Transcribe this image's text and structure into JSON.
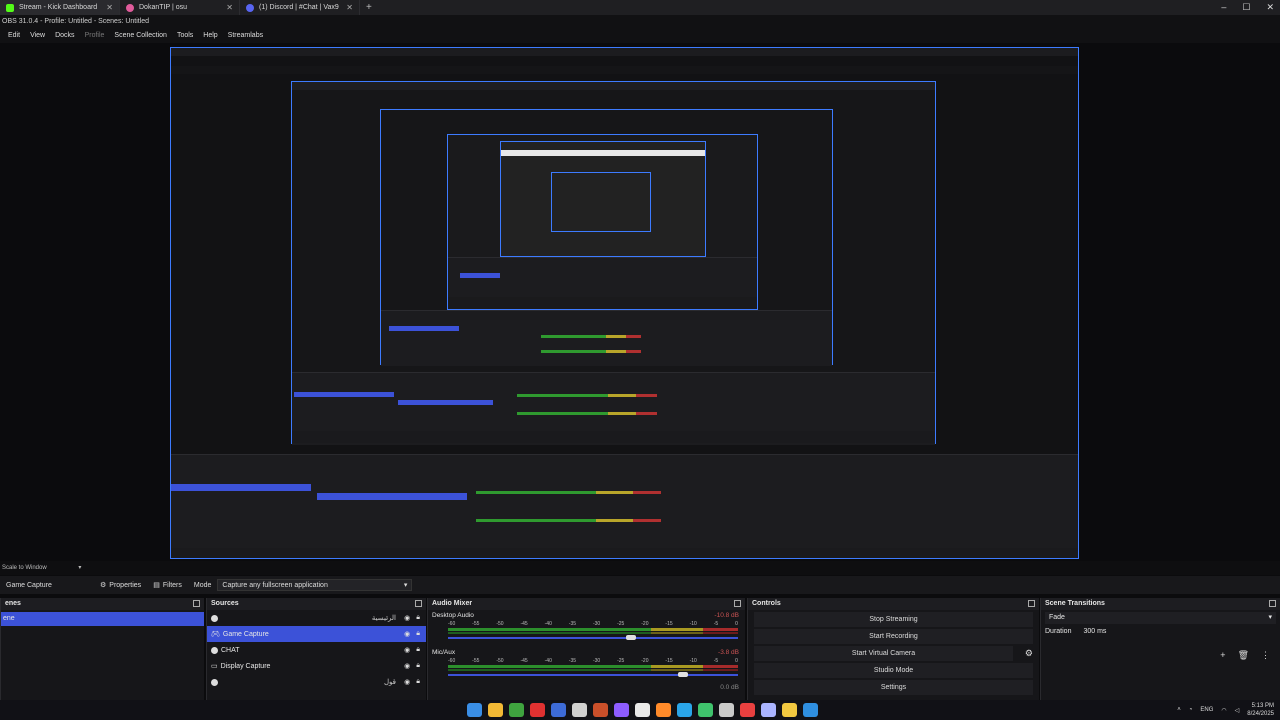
{
  "browser": {
    "tabs": [
      {
        "label": "Stream - Kick Dashboard",
        "color": "#53fc18"
      },
      {
        "label": "DokanTIP | osu",
        "color": "#e05b9b"
      },
      {
        "label": "(1) Discord | #Chat | Vax9",
        "color": "#5865f2"
      }
    ],
    "new_tab": "+"
  },
  "window": {
    "title": "OBS 31.0.4 - Profile: Untitled - Scenes: Untitled",
    "menu": [
      "Edit",
      "View",
      "Docks",
      "Profile",
      "Scene Collection",
      "Tools",
      "Help",
      "Streamlabs"
    ]
  },
  "scale_label": "Scale to Window",
  "source_toolbar": {
    "source_name": "Game Capture",
    "properties": "Properties",
    "filters": "Filters",
    "mode_label": "Mode",
    "mode_value": "Capture any fullscreen application"
  },
  "scenes": {
    "title": "enes",
    "items": [
      "ene"
    ]
  },
  "sources": {
    "title": "Sources",
    "items": [
      {
        "name": "",
        "rtl": "الرئيسية"
      },
      {
        "name": "Game Capture",
        "rtl": ""
      },
      {
        "name": "CHAT",
        "rtl": ""
      },
      {
        "name": "Display Capture",
        "rtl": ""
      },
      {
        "name": "",
        "rtl": "قول"
      }
    ]
  },
  "mixer": {
    "title": "Audio Mixer",
    "channels": [
      {
        "name": "Desktop Audio",
        "db": "-10.8 dB",
        "level": 0.63
      },
      {
        "name": "Mic/Aux",
        "db": "-3.8 dB",
        "level": 0.81
      }
    ],
    "ticks": [
      "-60",
      "-55",
      "-50",
      "-45",
      "-40",
      "-35",
      "-30",
      "-25",
      "-20",
      "-15",
      "-10",
      "-5",
      "0"
    ],
    "third_db": "0.0 dB"
  },
  "controls": {
    "title": "Controls",
    "buttons": [
      "Stop Streaming",
      "Start Recording",
      "Start Virtual Camera",
      "Studio Mode",
      "Settings"
    ]
  },
  "transitions": {
    "title": "Scene Transitions",
    "selected": "Fade",
    "duration_label": "Duration",
    "duration_value": "300 ms"
  },
  "taskbar": {
    "lang": "ENG",
    "time": "5:13 PM",
    "date": "8/24/2025",
    "icon_colors": [
      "#3a8ee6",
      "#f2b935",
      "#3fa33f",
      "#e03131",
      "#3d6bd8",
      "#cfcfcf",
      "#c94f2a",
      "#8d5cff",
      "#e8e8e8",
      "#ff8a2a",
      "#2aa4e8",
      "#3fc26d",
      "#c9c9c9",
      "#e84040",
      "#aab4ff",
      "#f2c840",
      "#2f8fe0"
    ]
  }
}
